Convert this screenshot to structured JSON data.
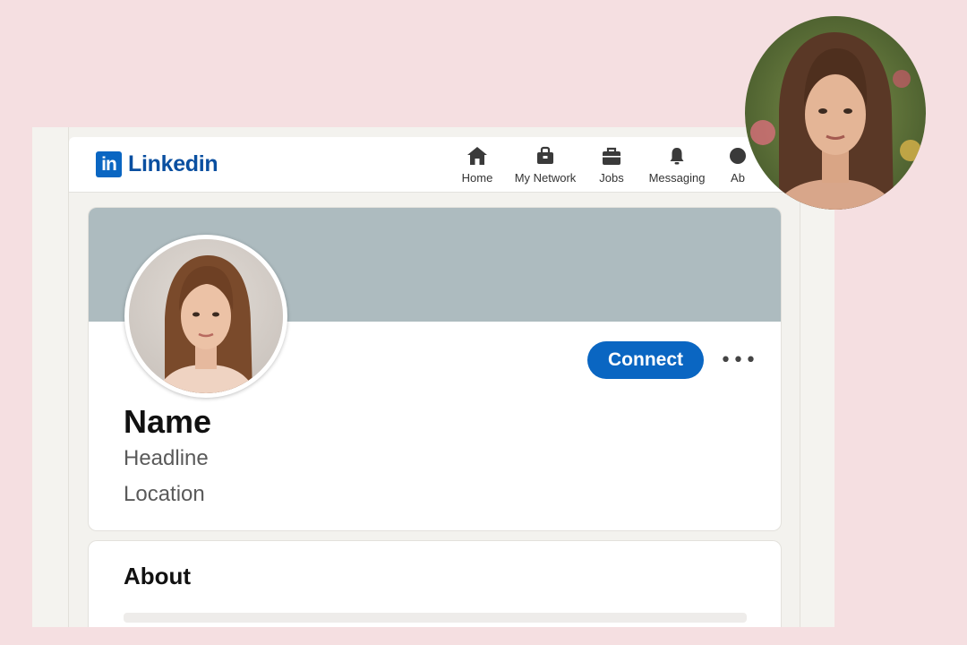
{
  "brand": {
    "logo_mark": "in",
    "name": "Linkedin",
    "color": "#0a66c2"
  },
  "nav": {
    "items": [
      {
        "label": "Home",
        "icon": "home-icon"
      },
      {
        "label": "My Network",
        "icon": "network-icon"
      },
      {
        "label": "Jobs",
        "icon": "briefcase-icon"
      },
      {
        "label": "Messaging",
        "icon": "bell-icon"
      },
      {
        "label": "Ab",
        "icon": "avatar-dot-icon"
      }
    ]
  },
  "profile": {
    "name": "Name",
    "headline": "Headline",
    "location": "Location",
    "connect_label": "Connect",
    "more_label": "•••",
    "banner_color": "#adbbbf"
  },
  "about": {
    "title": "About"
  },
  "colors": {
    "background": "#f5dfe1",
    "accent": "#0a66c2"
  }
}
